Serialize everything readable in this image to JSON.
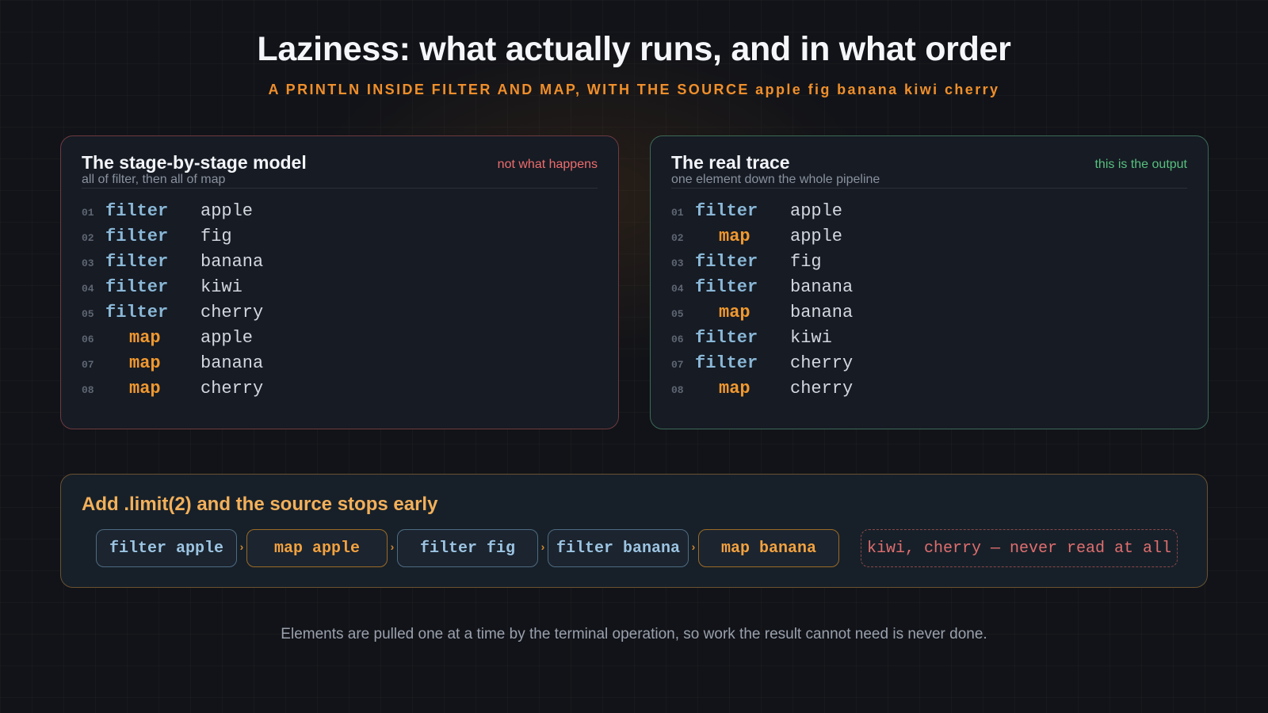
{
  "header": {
    "title": "Laziness: what actually runs, and in what order",
    "subtitle": "A PRINTLN INSIDE FILTER AND MAP, WITH THE SOURCE apple fig banana kiwi cherry"
  },
  "model_panel": {
    "title": "The stage-by-stage model",
    "subtitle": "all of filter, then all of map",
    "badge": "not what happens",
    "rows": [
      {
        "num": "01",
        "op": "filter",
        "value": "apple"
      },
      {
        "num": "02",
        "op": "filter",
        "value": "fig"
      },
      {
        "num": "03",
        "op": "filter",
        "value": "banana"
      },
      {
        "num": "04",
        "op": "filter",
        "value": "kiwi"
      },
      {
        "num": "05",
        "op": "filter",
        "value": "cherry"
      },
      {
        "num": "06",
        "op": "map",
        "value": "apple"
      },
      {
        "num": "07",
        "op": "map",
        "value": "banana"
      },
      {
        "num": "08",
        "op": "map",
        "value": "cherry"
      }
    ]
  },
  "trace_panel": {
    "title": "The real trace",
    "subtitle": "one element down the whole pipeline",
    "badge": "this is the output",
    "rows": [
      {
        "num": "01",
        "op": "filter",
        "value": "apple"
      },
      {
        "num": "02",
        "op": "map",
        "value": "apple"
      },
      {
        "num": "03",
        "op": "filter",
        "value": "fig"
      },
      {
        "num": "04",
        "op": "filter",
        "value": "banana"
      },
      {
        "num": "05",
        "op": "map",
        "value": "banana"
      },
      {
        "num": "06",
        "op": "filter",
        "value": "kiwi"
      },
      {
        "num": "07",
        "op": "filter",
        "value": "cherry"
      },
      {
        "num": "08",
        "op": "map",
        "value": "cherry"
      }
    ]
  },
  "limit_panel": {
    "title": "Add .limit(2) and the source stops early",
    "steps": [
      {
        "label": "filter apple",
        "kind": "filter"
      },
      {
        "label": "map apple",
        "kind": "map"
      },
      {
        "label": "filter fig",
        "kind": "filter"
      },
      {
        "label": "filter banana",
        "kind": "filter"
      },
      {
        "label": "map banana",
        "kind": "map"
      }
    ],
    "arrow_glyph": "›",
    "never_read": "kiwi, cherry — never read at all"
  },
  "footer": "Elements are pulled one at a time by the terminal operation, so work the result cannot need is never done.",
  "colors": {
    "filter": "#8ab7d6",
    "map": "#f0982f",
    "model_border": "#6e3a3f",
    "trace_border": "#3c6a55",
    "never": "#e06e6e"
  }
}
